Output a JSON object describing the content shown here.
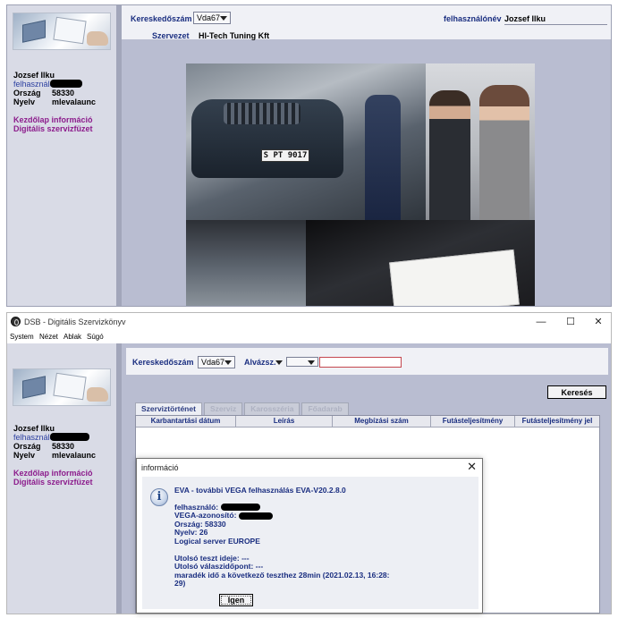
{
  "top_panel": {
    "sidebar": {
      "user_name": "Jozsef Ilku",
      "rows": [
        {
          "label": "felhasználó",
          "value": ""
        },
        {
          "label": "Ország",
          "value": "58330"
        },
        {
          "label": "Nyelv",
          "value": "mlevalaunc"
        }
      ],
      "links": [
        "Kezdőlap információ",
        "Digitális szervizfüzet"
      ]
    },
    "header": {
      "dealer_label": "Kereskedőszám",
      "dealer_value": "Vda67",
      "user_label": "felhasználónév",
      "user_value": "Jozsef Ilku",
      "org_label": "Szervezet",
      "org_value": "HI-Tech Tuning Kft"
    },
    "photo": {
      "plate_text": "S PT 9017"
    }
  },
  "window": {
    "title": "DSB - Digitális Szervizkönyv",
    "controls": {
      "minimize": "—",
      "maximize": "☐",
      "close": "✕"
    },
    "menu": [
      "System",
      "Nézet",
      "Ablak",
      "Súgó"
    ],
    "sidebar": {
      "user_name": "Jozsef Ilku",
      "rows": [
        {
          "label": "felhasználó",
          "value": ""
        },
        {
          "label": "Ország",
          "value": "58330"
        },
        {
          "label": "Nyelv",
          "value": "mlevalaunc"
        }
      ],
      "links": [
        "Kezdőlap információ",
        "Digitális szervizfüzet"
      ]
    },
    "filter": {
      "dealer_label": "Kereskedőszám",
      "dealer_value": "Vda67",
      "chassis_label": "Alvázsz.",
      "chassis_select": "",
      "search_value": ""
    },
    "search_button": "Keresés",
    "tabs": [
      "Szerviztörténet",
      "Szerviz",
      "Karosszéria",
      "Főadarab"
    ],
    "table_columns": [
      "Karbantartási dátum",
      "Leírás",
      "Megbízási szám",
      "Futásteljesítmény",
      "Futásteljesítmény jel"
    ]
  },
  "dialog": {
    "title": "információ",
    "close": "✕",
    "icon": "info-icon",
    "lines": [
      "EVA - további VEGA felhasználás EVA-V20.2.8.0",
      "",
      "felhasználó:",
      "VEGA-azonosító:",
      "Ország: 58330",
      "Nyelv: 26",
      "Logical server EUROPE",
      "",
      "Utolsó teszt ideje: ---",
      "Utolsó válaszidőpont: ---",
      "maradék idő a következő teszthez 28min (2021.02.13, 16:28:",
      "29)"
    ],
    "ok_button": "Igen"
  },
  "colors": {
    "panel_bg": "#b9bdd1",
    "sidebar_bg": "#d9dbe6",
    "label_blue": "#1a2e80",
    "link_purple": "#8c1c8c",
    "input_red": "#c4474f"
  }
}
